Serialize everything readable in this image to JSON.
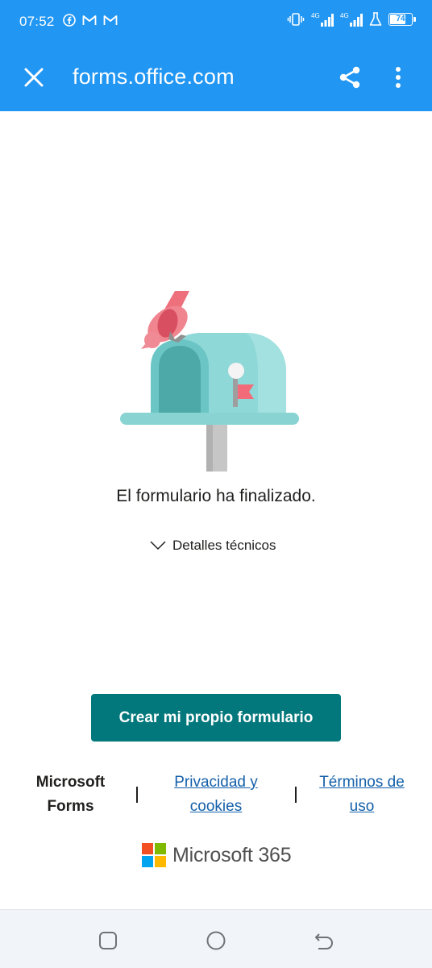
{
  "status_bar": {
    "time": "07:52",
    "battery": "74",
    "network_1": "4G",
    "network_2": "4G",
    "left_icons": [
      "facebook-icon",
      "gmail-icon",
      "gmail-icon"
    ],
    "right_icons": [
      "vibrate-icon",
      "signal-icon",
      "signal-icon",
      "flask-icon",
      "battery-icon"
    ]
  },
  "browser": {
    "url": "forms.office.com",
    "close_icon": "close-icon",
    "share_icon": "share-icon",
    "menu_icon": "more-vert-icon"
  },
  "main": {
    "illustration": "mailbox-bird-illustration",
    "message": "El formulario ha finalizado.",
    "details_label": "Detalles técnicos",
    "cta_label": "Crear mi propio formulario"
  },
  "footer": {
    "brand": "Microsoft Forms",
    "privacy": "Privacidad y cookies",
    "terms": "Términos de uso",
    "ms365": "Microsoft 365"
  },
  "colors": {
    "header": "#2196f3",
    "cta": "#03787c",
    "link": "#1460aa",
    "nav_bar": "#f1f4f9",
    "ms_red": "#f25022",
    "ms_green": "#7fba00",
    "ms_blue": "#00a4ef",
    "ms_yellow": "#ffb900"
  },
  "nav": {
    "items": [
      "recent-apps-icon",
      "home-icon",
      "back-icon"
    ]
  }
}
